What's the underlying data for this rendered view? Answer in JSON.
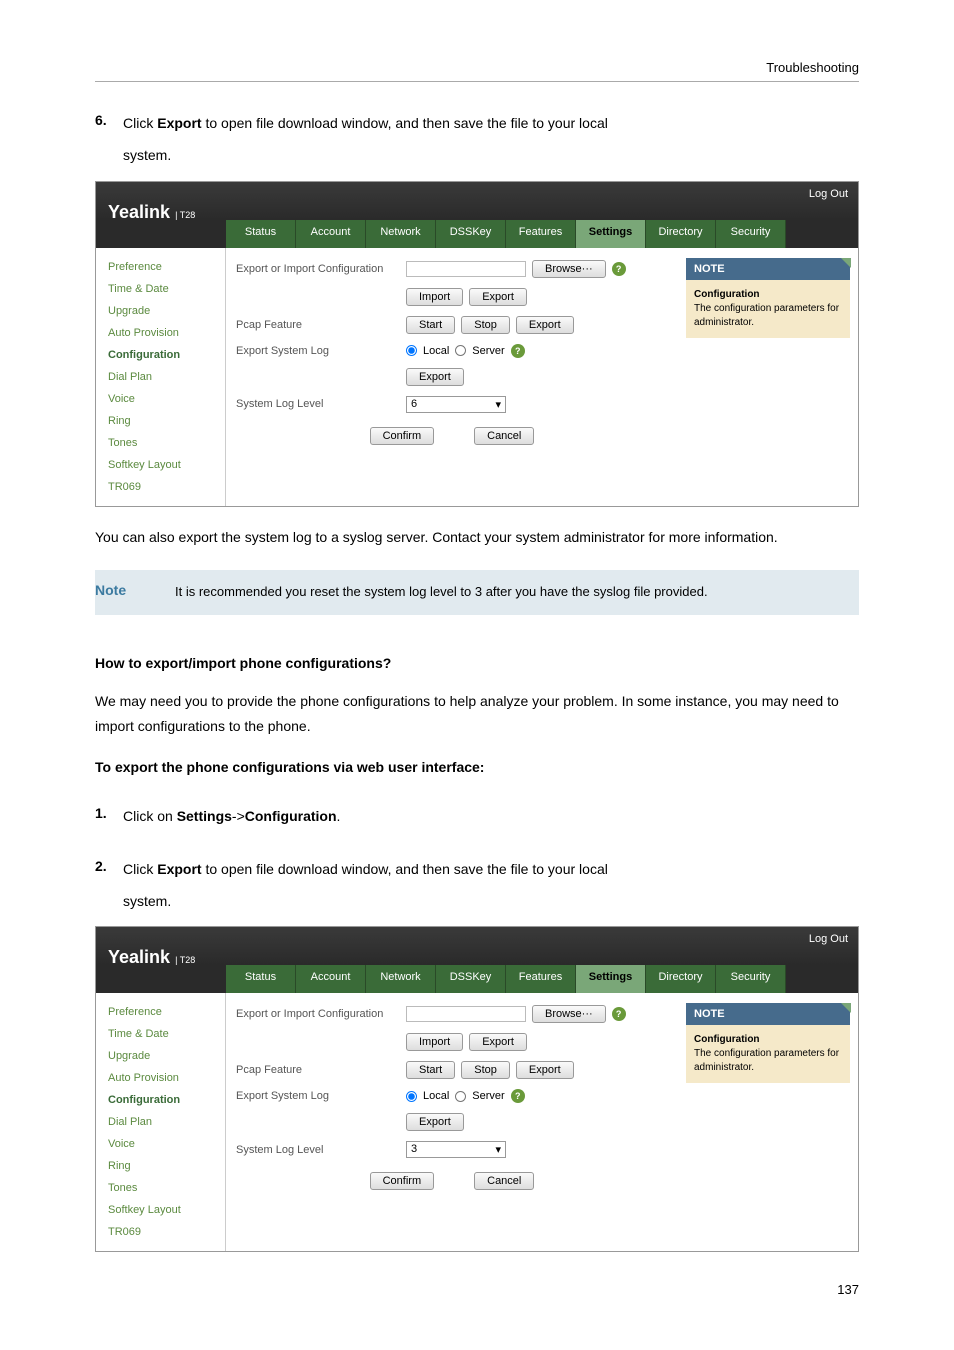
{
  "page_header": "Troubleshooting",
  "step6": {
    "num": "6.",
    "text_a": "Click ",
    "bold": "Export",
    "text_b": " to open file download window, and then save the file to your local",
    "line2": "system."
  },
  "ui1": {
    "logo": "Yealink",
    "model": "T28",
    "logout": "Log Out",
    "tabs": [
      "Status",
      "Account",
      "Network",
      "DSSKey",
      "Features",
      "Settings",
      "Directory",
      "Security"
    ],
    "active_tab": "Settings",
    "sidebar": [
      "Preference",
      "Time & Date",
      "Upgrade",
      "Auto Provision",
      "Configuration",
      "Dial Plan",
      "Voice",
      "Ring",
      "Tones",
      "Softkey Layout",
      "TR069"
    ],
    "active_side": "Configuration",
    "rows": {
      "export_import": "Export or Import Configuration",
      "browse": "Browse···",
      "import": "Import",
      "export": "Export",
      "pcap": "Pcap Feature",
      "start": "Start",
      "stop": "Stop",
      "export2": "Export",
      "syslog": "Export System Log",
      "local": "Local",
      "server": "Server",
      "export3": "Export",
      "loglevel": "System Log Level",
      "level_val": "6",
      "confirm": "Confirm",
      "cancel": "Cancel"
    },
    "note": {
      "title": "NOTE",
      "b": "Configuration",
      "t": "The configuration parameters for administrator."
    }
  },
  "para_after1": "You can also export the system log to a syslog server. Contact your system administrator for more information.",
  "note_box": {
    "label": "Note",
    "text": "It is recommended you reset the system log level to 3 after you have the syslog file provided."
  },
  "section_head": "How to export/import phone configurations?",
  "para2": "We may need you to provide the phone configurations to help analyze your problem. In some instance, you may need to import configurations to the phone.",
  "sub_head": "To export the phone configurations via web user interface:",
  "step1": {
    "num": "1.",
    "a": "Click on ",
    "b": "Settings",
    "gt": "->",
    "c": "Configuration",
    "dot": "."
  },
  "step2": {
    "num": "2.",
    "text_a": "Click ",
    "bold": "Export",
    "text_b": " to open file download window, and then save the file to your local",
    "line2": "system."
  },
  "ui2": {
    "logo": "Yealink",
    "model": "T28",
    "logout": "Log Out",
    "tabs": [
      "Status",
      "Account",
      "Network",
      "DSSKey",
      "Features",
      "Settings",
      "Directory",
      "Security"
    ],
    "active_tab": "Settings",
    "sidebar": [
      "Preference",
      "Time & Date",
      "Upgrade",
      "Auto Provision",
      "Configuration",
      "Dial Plan",
      "Voice",
      "Ring",
      "Tones",
      "Softkey Layout",
      "TR069"
    ],
    "active_side": "Configuration",
    "rows": {
      "export_import": "Export or Import Configuration",
      "browse": "Browse···",
      "import": "Import",
      "export": "Export",
      "pcap": "Pcap Feature",
      "start": "Start",
      "stop": "Stop",
      "export2": "Export",
      "syslog": "Export System Log",
      "local": "Local",
      "server": "Server",
      "export3": "Export",
      "loglevel": "System Log Level",
      "level_val": "3",
      "confirm": "Confirm",
      "cancel": "Cancel"
    },
    "note": {
      "title": "NOTE",
      "b": "Configuration",
      "t": "The configuration parameters for administrator."
    }
  },
  "page_num": "137"
}
